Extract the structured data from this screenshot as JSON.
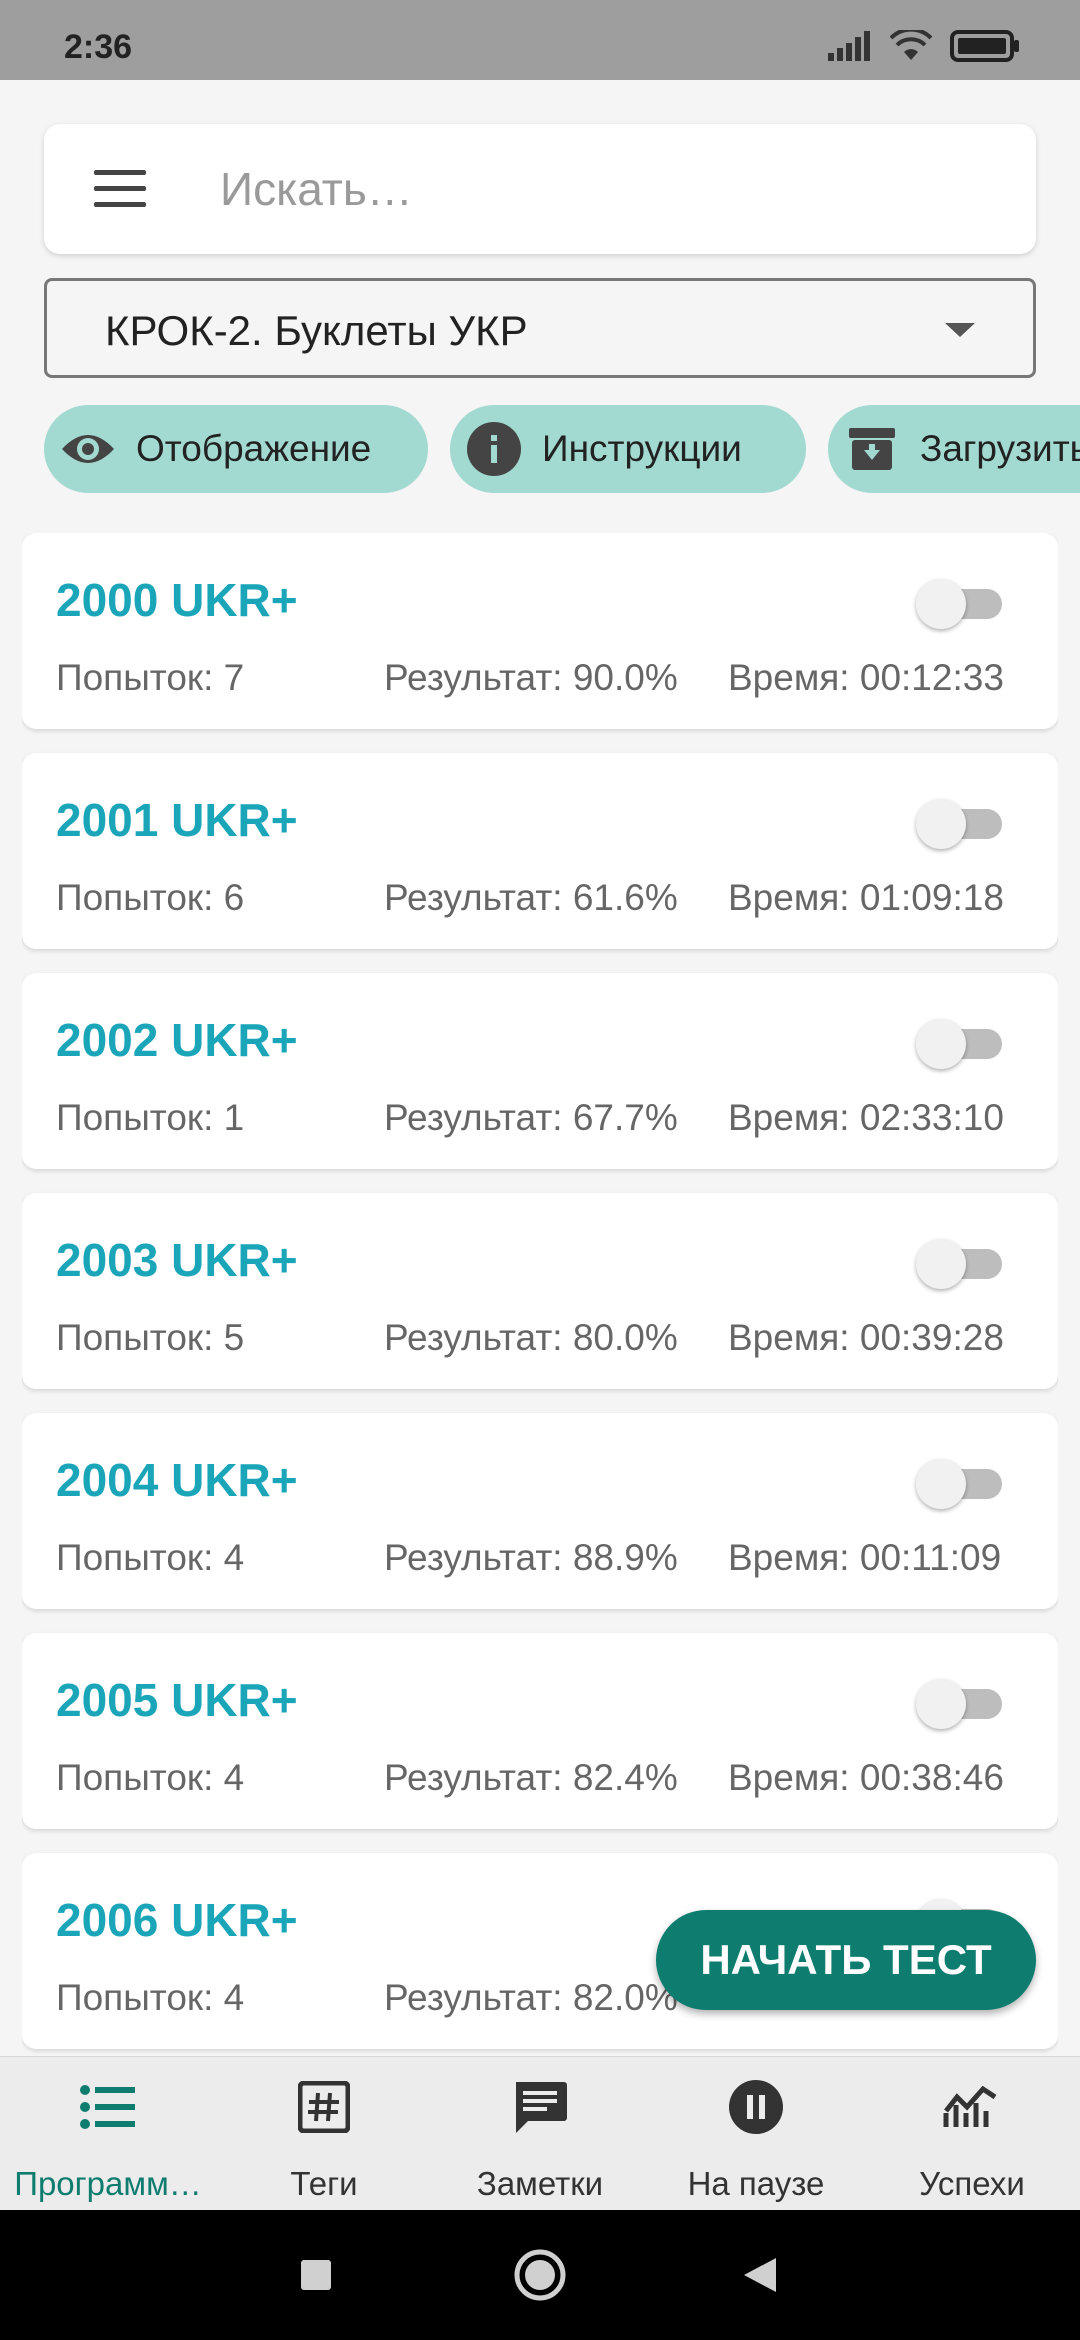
{
  "status_bar": {
    "time": "2:36"
  },
  "search": {
    "placeholder": "Искать…"
  },
  "dropdown": {
    "value": "КРОК-2. Буклеты УКР"
  },
  "chips": [
    {
      "label": "Отображение",
      "icon": "eye-icon"
    },
    {
      "label": "Инструкции",
      "icon": "info-icon"
    },
    {
      "label": "Загрузить",
      "icon": "archive-download-icon"
    }
  ],
  "list": [
    {
      "title": "2000 UKR+",
      "attempts": "Попыток: 7",
      "result": "Результат: 90.0%",
      "time": "Время: 00:12:33",
      "enabled": false
    },
    {
      "title": "2001 UKR+",
      "attempts": "Попыток: 6",
      "result": "Результат: 61.6%",
      "time": "Время: 01:09:18",
      "enabled": false
    },
    {
      "title": "2002 UKR+",
      "attempts": "Попыток: 1",
      "result": "Результат: 67.7%",
      "time": "Время: 02:33:10",
      "enabled": false
    },
    {
      "title": "2003 UKR+",
      "attempts": "Попыток: 5",
      "result": "Результат: 80.0%",
      "time": "Время: 00:39:28",
      "enabled": false
    },
    {
      "title": "2004 UKR+",
      "attempts": "Попыток: 4",
      "result": "Результат: 88.9%",
      "time": "Время: 00:11:09",
      "enabled": false
    },
    {
      "title": "2005 UKR+",
      "attempts": "Попыток: 4",
      "result": "Результат: 82.4%",
      "time": "Время: 00:38:46",
      "enabled": false
    },
    {
      "title": "2006 UKR+",
      "attempts": "Попыток: 4",
      "result": "Результат: 82.0%",
      "time": "",
      "enabled": false
    }
  ],
  "fab": {
    "label": "НАЧАТЬ ТЕСТ"
  },
  "bottom_nav": [
    {
      "label": "Программ…",
      "icon": "list-icon",
      "active": true
    },
    {
      "label": "Теги",
      "icon": "hashtag-icon",
      "active": false
    },
    {
      "label": "Заметки",
      "icon": "comment-icon",
      "active": false
    },
    {
      "label": "На паузе",
      "icon": "pause-icon",
      "active": false
    },
    {
      "label": "Успехи",
      "icon": "chart-icon",
      "active": false
    }
  ],
  "colors": {
    "accent": "#0e7d70",
    "title": "#1aa5b8",
    "chip": "#a2d9d1"
  }
}
